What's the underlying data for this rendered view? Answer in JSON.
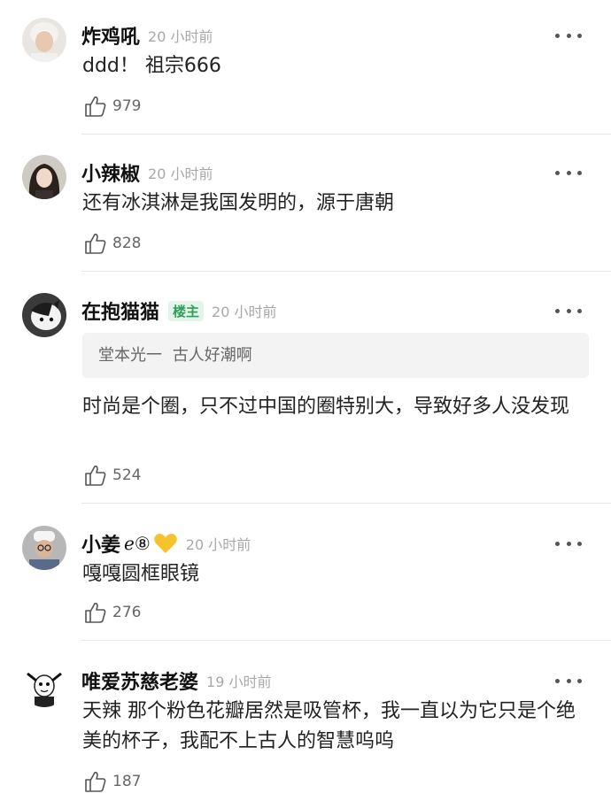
{
  "comments": [
    {
      "name": "炸鸡吼",
      "time": "20 小时前",
      "text": "ddd！ 祖宗666",
      "likes": "979",
      "avatar": "avatar-boy-white-hair"
    },
    {
      "name": "小辣椒",
      "time": "20 小时前",
      "text": "还有冰淇淋是我国发明的，源于唐朝",
      "likes": "828",
      "avatar": "avatar-girl-dark-hair"
    },
    {
      "name": "在抱猫猫",
      "badge": "楼主",
      "time": "20 小时前",
      "quote_author": "堂本光一",
      "quote_text": "古人好潮啊",
      "text": "时尚是个圈，只不过中国的圈特别大，导致好多人没发现",
      "likes": "524",
      "avatar": "avatar-cat"
    },
    {
      "name": "小姜",
      "name_emoji": "ℯ⑧",
      "heart": "yellow-heart-icon",
      "time": "20 小时前",
      "text": "嘎嘎圆框眼镜",
      "likes": "276",
      "avatar": "avatar-man-hat"
    },
    {
      "name": "唯爱苏慈老婆",
      "time": "19 小时前",
      "text": "天辣 那个粉色花瓣居然是吸管杯，我一直以为它只是个绝美的杯子，我配不上古人的智慧呜呜",
      "likes": "187",
      "avatar": "avatar-meme"
    }
  ],
  "colors": {
    "badge_green": "#2f9e57",
    "badge_bg": "#e3f5e9",
    "heart_yellow": "#f5c32c"
  }
}
